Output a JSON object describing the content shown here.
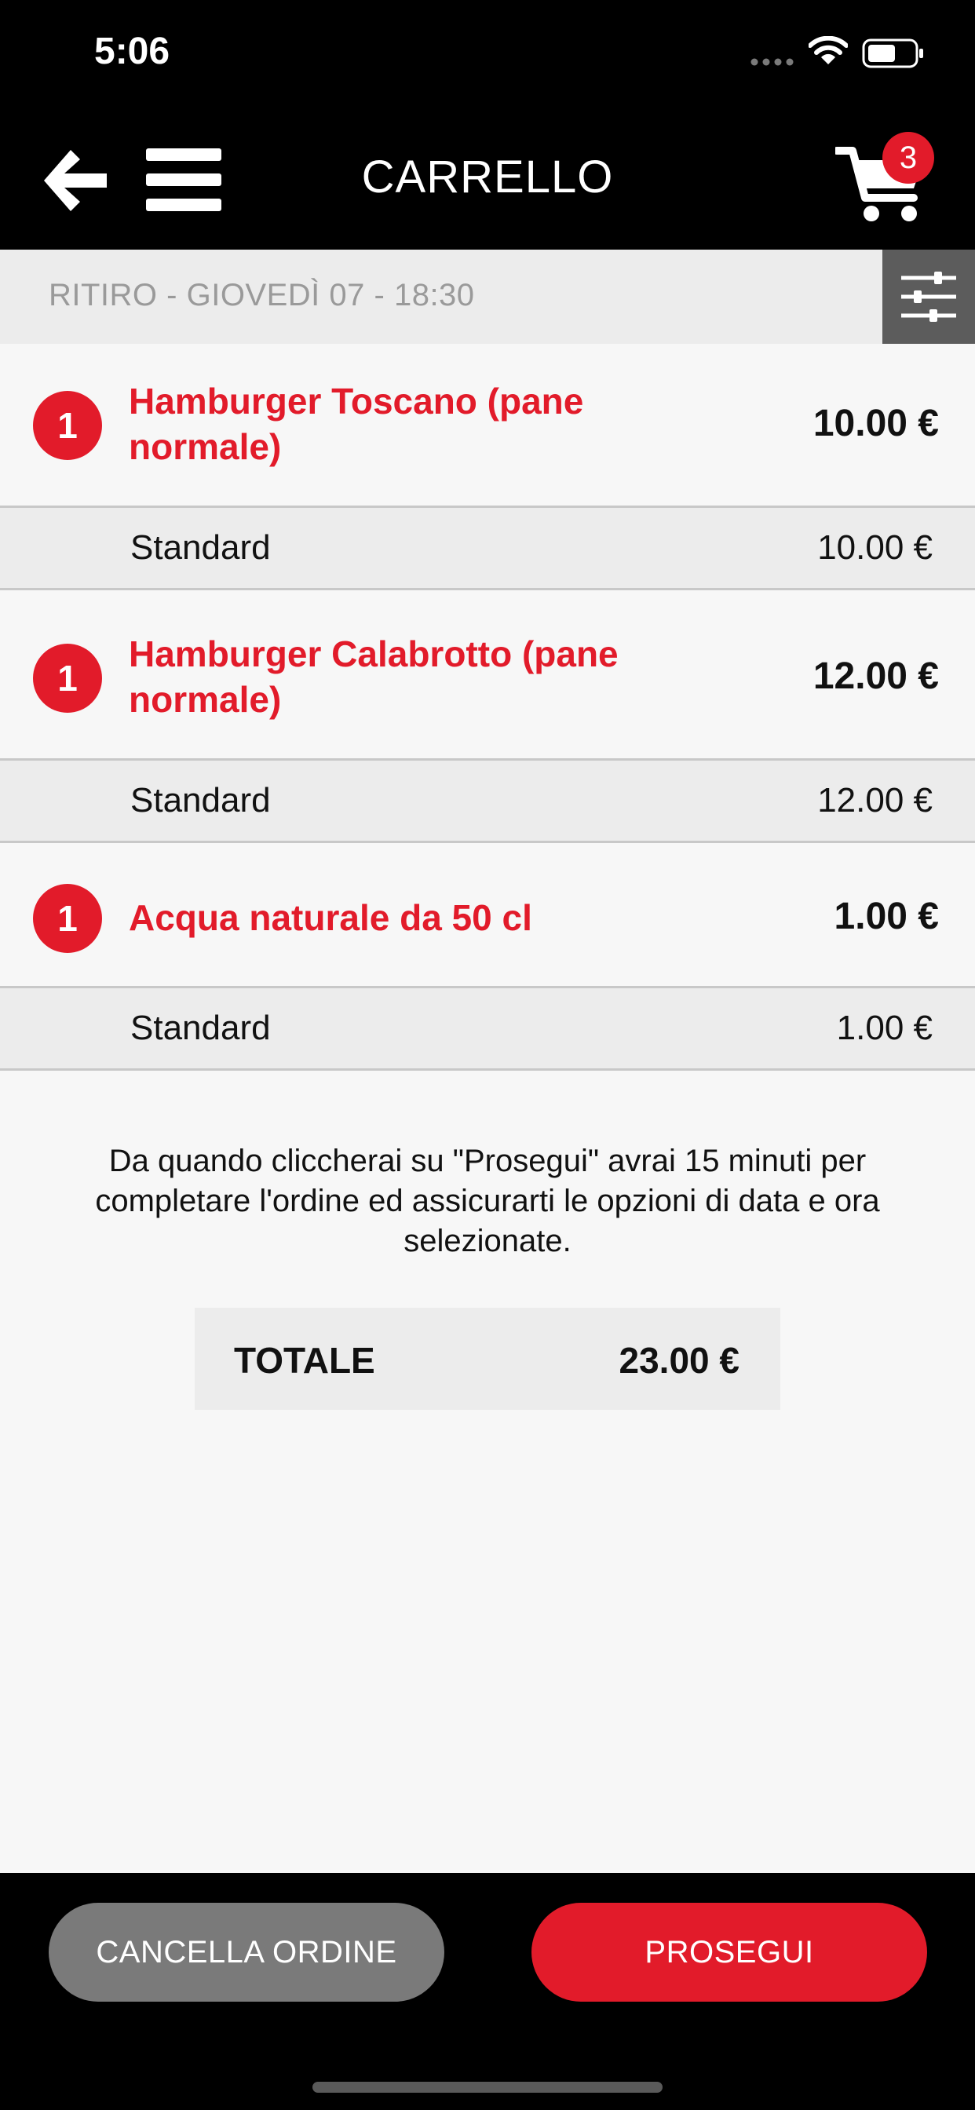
{
  "status_bar": {
    "time": "5:06"
  },
  "nav": {
    "title": "CARRELLO",
    "cart_count": "3"
  },
  "pickup": {
    "text": "RITIRO - GIOVEDÌ 07 - 18:30"
  },
  "items": [
    {
      "qty": "1",
      "name": "Hamburger Toscano (pane normale)",
      "price": "10.00 €",
      "variant": "Standard",
      "variant_price": "10.00 €"
    },
    {
      "qty": "1",
      "name": "Hamburger Calabrotto (pane normale)",
      "price": "12.00 €",
      "variant": "Standard",
      "variant_price": "12.00 €"
    },
    {
      "qty": "1",
      "name": "Acqua naturale da 50 cl",
      "price": "1.00 €",
      "variant": "Standard",
      "variant_price": "1.00 €"
    }
  ],
  "notice": "Da quando cliccherai su \"Prosegui\" avrai 15 minuti per completare l'ordine ed assicurarti le opzioni di data e ora selezionate.",
  "total": {
    "label": "TOTALE",
    "value": "23.00 €"
  },
  "actions": {
    "cancel_label": "CANCELLA ORDINE",
    "continue_label": "PROSEGUI"
  },
  "colors": {
    "accent": "#e21b2a",
    "bar": "#000000",
    "panel": "#ececec",
    "background": "#f7f7f7"
  }
}
